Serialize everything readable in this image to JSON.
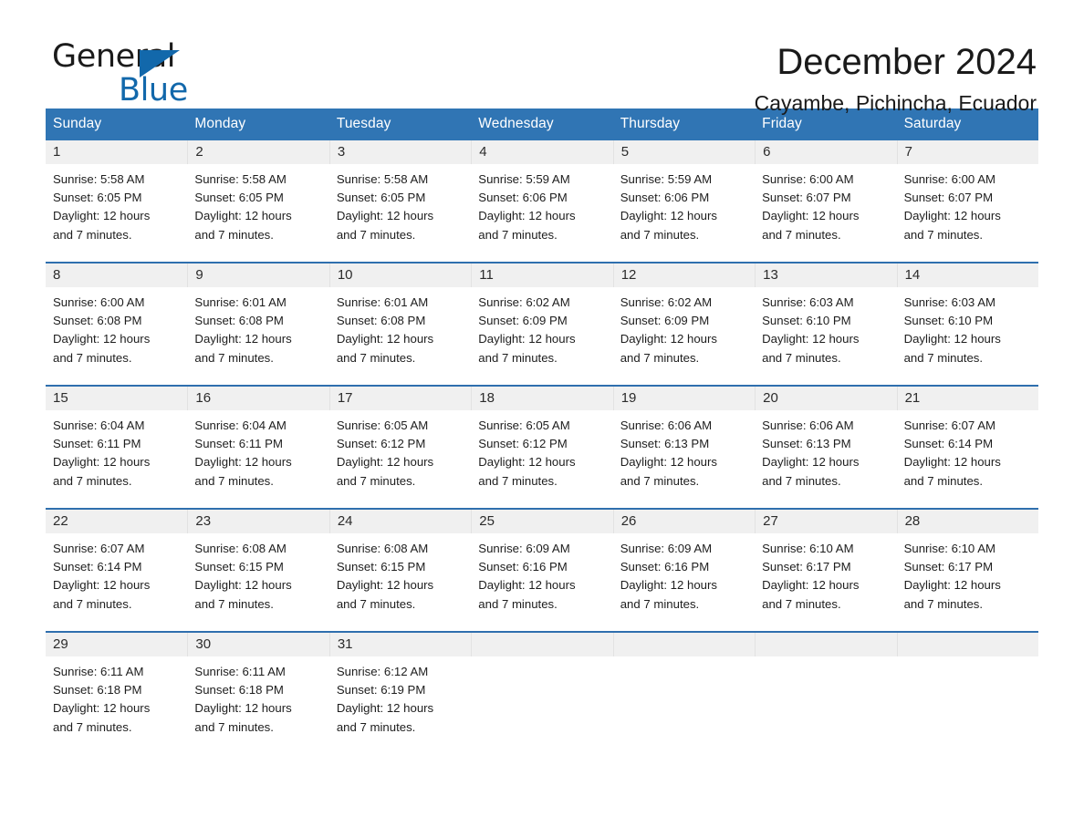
{
  "brand": {
    "name_top": "General",
    "name_bottom": "Blue",
    "flag_icon": "triangle-flag-icon",
    "accent_color": "#1268ab"
  },
  "header": {
    "title": "December 2024",
    "subtitle": "Cayambe, Pichincha, Ecuador"
  },
  "theme": {
    "header_blue": "#3075b4",
    "divider_blue": "#2f6fae",
    "daynum_band": "#f0f0f0",
    "text": "#1d1d1d"
  },
  "weekdays": [
    "Sunday",
    "Monday",
    "Tuesday",
    "Wednesday",
    "Thursday",
    "Friday",
    "Saturday"
  ],
  "weeks": [
    [
      {
        "day": "1",
        "sunrise": "Sunrise: 5:58 AM",
        "sunset": "Sunset: 6:05 PM",
        "daylight_1": "Daylight: 12 hours",
        "daylight_2": "and 7 minutes."
      },
      {
        "day": "2",
        "sunrise": "Sunrise: 5:58 AM",
        "sunset": "Sunset: 6:05 PM",
        "daylight_1": "Daylight: 12 hours",
        "daylight_2": "and 7 minutes."
      },
      {
        "day": "3",
        "sunrise": "Sunrise: 5:58 AM",
        "sunset": "Sunset: 6:05 PM",
        "daylight_1": "Daylight: 12 hours",
        "daylight_2": "and 7 minutes."
      },
      {
        "day": "4",
        "sunrise": "Sunrise: 5:59 AM",
        "sunset": "Sunset: 6:06 PM",
        "daylight_1": "Daylight: 12 hours",
        "daylight_2": "and 7 minutes."
      },
      {
        "day": "5",
        "sunrise": "Sunrise: 5:59 AM",
        "sunset": "Sunset: 6:06 PM",
        "daylight_1": "Daylight: 12 hours",
        "daylight_2": "and 7 minutes."
      },
      {
        "day": "6",
        "sunrise": "Sunrise: 6:00 AM",
        "sunset": "Sunset: 6:07 PM",
        "daylight_1": "Daylight: 12 hours",
        "daylight_2": "and 7 minutes."
      },
      {
        "day": "7",
        "sunrise": "Sunrise: 6:00 AM",
        "sunset": "Sunset: 6:07 PM",
        "daylight_1": "Daylight: 12 hours",
        "daylight_2": "and 7 minutes."
      }
    ],
    [
      {
        "day": "8",
        "sunrise": "Sunrise: 6:00 AM",
        "sunset": "Sunset: 6:08 PM",
        "daylight_1": "Daylight: 12 hours",
        "daylight_2": "and 7 minutes."
      },
      {
        "day": "9",
        "sunrise": "Sunrise: 6:01 AM",
        "sunset": "Sunset: 6:08 PM",
        "daylight_1": "Daylight: 12 hours",
        "daylight_2": "and 7 minutes."
      },
      {
        "day": "10",
        "sunrise": "Sunrise: 6:01 AM",
        "sunset": "Sunset: 6:08 PM",
        "daylight_1": "Daylight: 12 hours",
        "daylight_2": "and 7 minutes."
      },
      {
        "day": "11",
        "sunrise": "Sunrise: 6:02 AM",
        "sunset": "Sunset: 6:09 PM",
        "daylight_1": "Daylight: 12 hours",
        "daylight_2": "and 7 minutes."
      },
      {
        "day": "12",
        "sunrise": "Sunrise: 6:02 AM",
        "sunset": "Sunset: 6:09 PM",
        "daylight_1": "Daylight: 12 hours",
        "daylight_2": "and 7 minutes."
      },
      {
        "day": "13",
        "sunrise": "Sunrise: 6:03 AM",
        "sunset": "Sunset: 6:10 PM",
        "daylight_1": "Daylight: 12 hours",
        "daylight_2": "and 7 minutes."
      },
      {
        "day": "14",
        "sunrise": "Sunrise: 6:03 AM",
        "sunset": "Sunset: 6:10 PM",
        "daylight_1": "Daylight: 12 hours",
        "daylight_2": "and 7 minutes."
      }
    ],
    [
      {
        "day": "15",
        "sunrise": "Sunrise: 6:04 AM",
        "sunset": "Sunset: 6:11 PM",
        "daylight_1": "Daylight: 12 hours",
        "daylight_2": "and 7 minutes."
      },
      {
        "day": "16",
        "sunrise": "Sunrise: 6:04 AM",
        "sunset": "Sunset: 6:11 PM",
        "daylight_1": "Daylight: 12 hours",
        "daylight_2": "and 7 minutes."
      },
      {
        "day": "17",
        "sunrise": "Sunrise: 6:05 AM",
        "sunset": "Sunset: 6:12 PM",
        "daylight_1": "Daylight: 12 hours",
        "daylight_2": "and 7 minutes."
      },
      {
        "day": "18",
        "sunrise": "Sunrise: 6:05 AM",
        "sunset": "Sunset: 6:12 PM",
        "daylight_1": "Daylight: 12 hours",
        "daylight_2": "and 7 minutes."
      },
      {
        "day": "19",
        "sunrise": "Sunrise: 6:06 AM",
        "sunset": "Sunset: 6:13 PM",
        "daylight_1": "Daylight: 12 hours",
        "daylight_2": "and 7 minutes."
      },
      {
        "day": "20",
        "sunrise": "Sunrise: 6:06 AM",
        "sunset": "Sunset: 6:13 PM",
        "daylight_1": "Daylight: 12 hours",
        "daylight_2": "and 7 minutes."
      },
      {
        "day": "21",
        "sunrise": "Sunrise: 6:07 AM",
        "sunset": "Sunset: 6:14 PM",
        "daylight_1": "Daylight: 12 hours",
        "daylight_2": "and 7 minutes."
      }
    ],
    [
      {
        "day": "22",
        "sunrise": "Sunrise: 6:07 AM",
        "sunset": "Sunset: 6:14 PM",
        "daylight_1": "Daylight: 12 hours",
        "daylight_2": "and 7 minutes."
      },
      {
        "day": "23",
        "sunrise": "Sunrise: 6:08 AM",
        "sunset": "Sunset: 6:15 PM",
        "daylight_1": "Daylight: 12 hours",
        "daylight_2": "and 7 minutes."
      },
      {
        "day": "24",
        "sunrise": "Sunrise: 6:08 AM",
        "sunset": "Sunset: 6:15 PM",
        "daylight_1": "Daylight: 12 hours",
        "daylight_2": "and 7 minutes."
      },
      {
        "day": "25",
        "sunrise": "Sunrise: 6:09 AM",
        "sunset": "Sunset: 6:16 PM",
        "daylight_1": "Daylight: 12 hours",
        "daylight_2": "and 7 minutes."
      },
      {
        "day": "26",
        "sunrise": "Sunrise: 6:09 AM",
        "sunset": "Sunset: 6:16 PM",
        "daylight_1": "Daylight: 12 hours",
        "daylight_2": "and 7 minutes."
      },
      {
        "day": "27",
        "sunrise": "Sunrise: 6:10 AM",
        "sunset": "Sunset: 6:17 PM",
        "daylight_1": "Daylight: 12 hours",
        "daylight_2": "and 7 minutes."
      },
      {
        "day": "28",
        "sunrise": "Sunrise: 6:10 AM",
        "sunset": "Sunset: 6:17 PM",
        "daylight_1": "Daylight: 12 hours",
        "daylight_2": "and 7 minutes."
      }
    ],
    [
      {
        "day": "29",
        "sunrise": "Sunrise: 6:11 AM",
        "sunset": "Sunset: 6:18 PM",
        "daylight_1": "Daylight: 12 hours",
        "daylight_2": "and 7 minutes."
      },
      {
        "day": "30",
        "sunrise": "Sunrise: 6:11 AM",
        "sunset": "Sunset: 6:18 PM",
        "daylight_1": "Daylight: 12 hours",
        "daylight_2": "and 7 minutes."
      },
      {
        "day": "31",
        "sunrise": "Sunrise: 6:12 AM",
        "sunset": "Sunset: 6:19 PM",
        "daylight_1": "Daylight: 12 hours",
        "daylight_2": "and 7 minutes."
      },
      {
        "day": "",
        "sunrise": "",
        "sunset": "",
        "daylight_1": "",
        "daylight_2": ""
      },
      {
        "day": "",
        "sunrise": "",
        "sunset": "",
        "daylight_1": "",
        "daylight_2": ""
      },
      {
        "day": "",
        "sunrise": "",
        "sunset": "",
        "daylight_1": "",
        "daylight_2": ""
      },
      {
        "day": "",
        "sunrise": "",
        "sunset": "",
        "daylight_1": "",
        "daylight_2": ""
      }
    ]
  ]
}
